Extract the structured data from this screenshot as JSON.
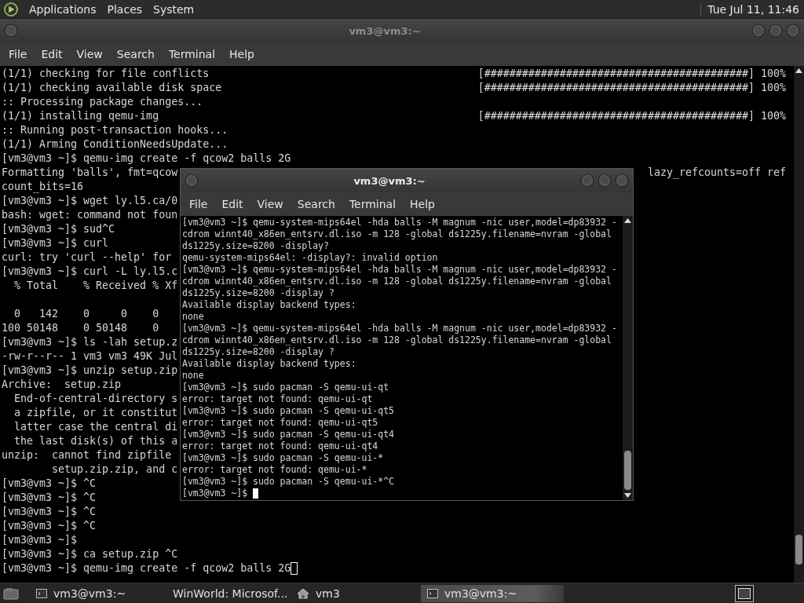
{
  "top_panel": {
    "menus": [
      "Applications",
      "Places",
      "System"
    ],
    "clock": "Tue Jul 11, 11:46"
  },
  "back_terminal": {
    "title": "vm3@vm3:~",
    "focused": false,
    "menu": [
      "File",
      "Edit",
      "View",
      "Search",
      "Terminal",
      "Help"
    ],
    "lines": [
      {
        "text": "(1/1) checking for file conflicts",
        "right": "[##########################################] 100%"
      },
      {
        "text": "(1/1) checking available disk space",
        "right": "[##########################################] 100%"
      },
      {
        "text": ":: Processing package changes..."
      },
      {
        "text": "(1/1) installing qemu-img",
        "right": "[##########################################] 100%"
      },
      {
        "text": ":: Running post-transaction hooks..."
      },
      {
        "text": "(1/1) Arming ConditionNeedsUpdate..."
      },
      {
        "text": "[vm3@vm3 ~]$ qemu-img create -f qcow2 balls 2G"
      },
      {
        "text": "Formatting 'balls', fmt=qcow",
        "right": "lazy_refcounts=off ref"
      },
      {
        "text": "count_bits=16"
      },
      {
        "text": "[vm3@vm3 ~]$ wget ly.l5.ca/0"
      },
      {
        "text": "bash: wget: command not foun"
      },
      {
        "text": "[vm3@vm3 ~]$ sud^C"
      },
      {
        "text": "[vm3@vm3 ~]$ curl"
      },
      {
        "text": "curl: try 'curl --help' for"
      },
      {
        "text": "[vm3@vm3 ~]$ curl -L ly.l5.c"
      },
      {
        "text": "  % Total    % Received % Xf"
      },
      {
        "text": "  0   142    0     0    0",
        "spaced": true
      },
      {
        "text": "100 50148    0 50148    0"
      },
      {
        "text": "[vm3@vm3 ~]$ ls -lah setup.z"
      },
      {
        "text": "-rw-r--r-- 1 vm3 vm3 49K Jul"
      },
      {
        "text": "[vm3@vm3 ~]$ unzip setup.zip"
      },
      {
        "text": "Archive:  setup.zip"
      },
      {
        "text": "  End-of-central-directory s"
      },
      {
        "text": "  a zipfile, or it constitut"
      },
      {
        "text": "  latter case the central di"
      },
      {
        "text": "  the last disk(s) of this a"
      },
      {
        "text": "unzip:  cannot find zipfile"
      },
      {
        "text": "        setup.zip.zip, and c"
      },
      {
        "text": "[vm3@vm3 ~]$ ^C"
      },
      {
        "text": "[vm3@vm3 ~]$ ^C"
      },
      {
        "text": "[vm3@vm3 ~]$ ^C"
      },
      {
        "text": "[vm3@vm3 ~]$ ^C"
      },
      {
        "text": "[vm3@vm3 ~]$"
      },
      {
        "text": "[vm3@vm3 ~]$ ca setup.zip ^C"
      },
      {
        "text": "[vm3@vm3 ~]$ qemu-img create -f qcow2 balls 2G"
      }
    ]
  },
  "front_terminal": {
    "title": "vm3@vm3:~",
    "focused": true,
    "menu": [
      "File",
      "Edit",
      "View",
      "Search",
      "Terminal",
      "Help"
    ],
    "lines": [
      {
        "text": "[vm3@vm3 ~]$ qemu-system-mips64el -hda balls -M magnum -nic user,model=dp83932 -"
      },
      {
        "text": "cdrom winnt40_x86en_entsrv.dl.iso -m 128 -global ds1225y.filename=nvram -global"
      },
      {
        "text": "ds1225y.size=8200 -display?"
      },
      {
        "text": "qemu-system-mips64el: -display?: invalid option"
      },
      {
        "text": "[vm3@vm3 ~]$ qemu-system-mips64el -hda balls -M magnum -nic user,model=dp83932 -"
      },
      {
        "text": "cdrom winnt40_x86en_entsrv.dl.iso -m 128 -global ds1225y.filename=nvram -global"
      },
      {
        "text": "ds1225y.size=8200 -display ?"
      },
      {
        "text": "Available display backend types:"
      },
      {
        "text": "none"
      },
      {
        "text": "[vm3@vm3 ~]$ qemu-system-mips64el -hda balls -M magnum -nic user,model=dp83932 -"
      },
      {
        "text": "cdrom winnt40_x86en_entsrv.dl.iso -m 128 -global ds1225y.filename=nvram -global"
      },
      {
        "text": "ds1225y.size=8200 -display ?"
      },
      {
        "text": "Available display backend types:"
      },
      {
        "text": "none"
      },
      {
        "text": "[vm3@vm3 ~]$ sudo pacman -S qemu-ui-qt"
      },
      {
        "text": "error: target not found: qemu-ui-qt"
      },
      {
        "text": "[vm3@vm3 ~]$ sudo pacman -S qemu-ui-qt5"
      },
      {
        "text": "error: target not found: qemu-ui-qt5"
      },
      {
        "text": "[vm3@vm3 ~]$ sudo pacman -S qemu-ui-qt4"
      },
      {
        "text": "error: target not found: qemu-ui-qt4"
      },
      {
        "text": "[vm3@vm3 ~]$ sudo pacman -S qemu-ui-*"
      },
      {
        "text": "error: target not found: qemu-ui-*"
      },
      {
        "text": "[vm3@vm3 ~]$ sudo pacman -S qemu-ui-*^C"
      },
      {
        "text": "[vm3@vm3 ~]$ "
      }
    ]
  },
  "taskbar": {
    "items": [
      {
        "label": "vm3@vm3:~",
        "kind": "terminal",
        "selected": false
      },
      {
        "label": "WinWorld: Microsof...",
        "kind": "browser",
        "selected": false
      },
      {
        "label": "vm3",
        "kind": "folder",
        "selected": false
      },
      {
        "label": "vm3@vm3:~",
        "kind": "terminal",
        "selected": true
      }
    ]
  }
}
